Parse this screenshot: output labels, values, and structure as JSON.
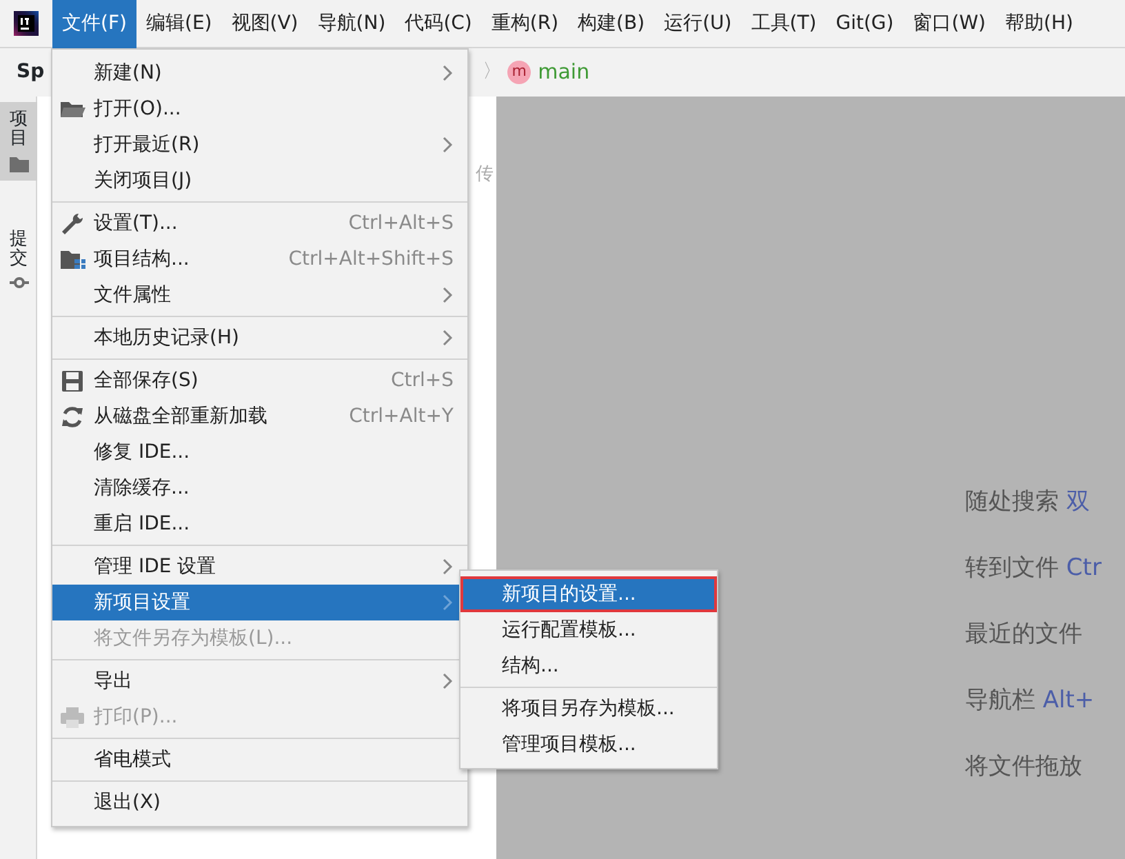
{
  "menubar": [
    {
      "label": "文件(F)",
      "selected": true
    },
    {
      "label": "编辑(E)",
      "selected": false
    },
    {
      "label": "视图(V)",
      "selected": false
    },
    {
      "label": "导航(N)",
      "selected": false
    },
    {
      "label": "代码(C)",
      "selected": false
    },
    {
      "label": "重构(R)",
      "selected": false
    },
    {
      "label": "构建(B)",
      "selected": false
    },
    {
      "label": "运行(U)",
      "selected": false
    },
    {
      "label": "工具(T)",
      "selected": false
    },
    {
      "label": "Git(G)",
      "selected": false
    },
    {
      "label": "窗口(W)",
      "selected": false
    },
    {
      "label": "帮助(H)",
      "selected": false
    }
  ],
  "navbar": {
    "project": "Sp",
    "separator": "〉",
    "branch_badge": "m",
    "branch": "main"
  },
  "tool_strip": [
    {
      "label": "项目",
      "selected": true
    },
    {
      "label": "提交",
      "selected": false
    }
  ],
  "project_panel": {
    "fragment": "传"
  },
  "file_menu": {
    "groups": [
      [
        {
          "label": "新建(N)",
          "submenu": true,
          "disabled": false,
          "selected": false
        },
        {
          "label": "打开(O)...",
          "submenu": false,
          "disabled": false,
          "selected": false
        },
        {
          "label": "打开最近(R)",
          "submenu": true,
          "disabled": false,
          "selected": false
        },
        {
          "label": "关闭项目(J)",
          "submenu": false,
          "disabled": false,
          "selected": false
        }
      ],
      [
        {
          "label": "设置(T)...",
          "shortcut": "Ctrl+Alt+S",
          "submenu": false,
          "disabled": false,
          "selected": false
        },
        {
          "label": "项目结构...",
          "shortcut": "Ctrl+Alt+Shift+S",
          "submenu": false,
          "disabled": false,
          "selected": false
        },
        {
          "label": "文件属性",
          "submenu": true,
          "disabled": false,
          "selected": false
        }
      ],
      [
        {
          "label": "本地历史记录(H)",
          "submenu": true,
          "disabled": false,
          "selected": false
        }
      ],
      [
        {
          "label": "全部保存(S)",
          "shortcut": "Ctrl+S",
          "submenu": false,
          "disabled": false,
          "selected": false
        },
        {
          "label": "从磁盘全部重新加载",
          "shortcut": "Ctrl+Alt+Y",
          "submenu": false,
          "disabled": false,
          "selected": false
        },
        {
          "label": "修复 IDE...",
          "submenu": false,
          "disabled": false,
          "selected": false
        },
        {
          "label": "清除缓存...",
          "submenu": false,
          "disabled": false,
          "selected": false
        },
        {
          "label": "重启 IDE...",
          "submenu": false,
          "disabled": false,
          "selected": false
        }
      ],
      [
        {
          "label": "管理 IDE 设置",
          "submenu": true,
          "disabled": false,
          "selected": false
        },
        {
          "label": "新项目设置",
          "submenu": true,
          "disabled": false,
          "selected": true
        },
        {
          "label": "将文件另存为模板(L)...",
          "submenu": false,
          "disabled": true,
          "selected": false
        }
      ],
      [
        {
          "label": "导出",
          "submenu": true,
          "disabled": false,
          "selected": false
        },
        {
          "label": "打印(P)...",
          "submenu": false,
          "disabled": true,
          "selected": false
        }
      ],
      [
        {
          "label": "省电模式",
          "submenu": false,
          "disabled": false,
          "selected": false
        }
      ],
      [
        {
          "label": "退出(X)",
          "submenu": false,
          "disabled": false,
          "selected": false
        }
      ]
    ]
  },
  "submenu": {
    "groups": [
      [
        {
          "label": "新项目的设置...",
          "selected": true,
          "outlined": true
        },
        {
          "label": "运行配置模板...",
          "selected": false,
          "outlined": false
        },
        {
          "label": "结构...",
          "selected": false,
          "outlined": false
        }
      ],
      [
        {
          "label": "将项目另存为模板...",
          "selected": false,
          "outlined": false
        },
        {
          "label": "管理项目模板...",
          "selected": false,
          "outlined": false
        }
      ]
    ]
  },
  "editor_hints": [
    {
      "label": "随处搜索",
      "shortcut": "双"
    },
    {
      "label": "转到文件",
      "shortcut": "Ctr"
    },
    {
      "label": "最近的文件"
    },
    {
      "label": "导航栏",
      "shortcut": "Alt+"
    },
    {
      "label": "将文件拖放"
    }
  ]
}
